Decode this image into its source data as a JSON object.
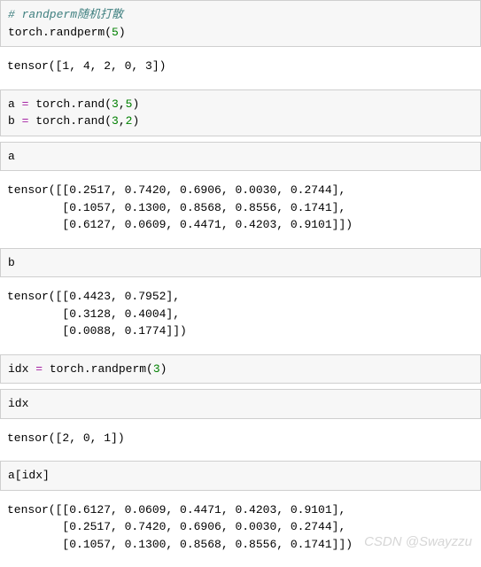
{
  "cells": {
    "c1_comment": "# randperm随机打散",
    "c1_code": "torch.randperm(",
    "c1_num": "5",
    "c1_close": ")",
    "o1": "tensor([1, 4, 2, 0, 3])",
    "c2_l1a": "a ",
    "c2_l1b": " torch.rand(",
    "c2_l1n1": "3",
    "c2_l1n2": "5",
    "c2_l1c": ")",
    "c2_l2a": "b ",
    "c2_l2b": " torch.rand(",
    "c2_l2n1": "3",
    "c2_l2n2": "2",
    "c2_l2c": ")",
    "eq": "=",
    "comma": ",",
    "c3": "a",
    "o3": "tensor([[0.2517, 0.7420, 0.6906, 0.0030, 0.2744],\n        [0.1057, 0.1300, 0.8568, 0.8556, 0.1741],\n        [0.6127, 0.0609, 0.4471, 0.4203, 0.9101]])",
    "c4": "b",
    "o4": "tensor([[0.4423, 0.7952],\n        [0.3128, 0.4004],\n        [0.0088, 0.1774]])",
    "c5a": "idx ",
    "c5b": " torch.randperm(",
    "c5n": "3",
    "c5c": ")",
    "c6": "idx",
    "o6": "tensor([2, 0, 1])",
    "c7": "a[idx]",
    "o7": "tensor([[0.6127, 0.0609, 0.4471, 0.4203, 0.9101],\n        [0.2517, 0.7420, 0.6906, 0.0030, 0.2744],\n        [0.1057, 0.1300, 0.8568, 0.8556, 0.1741]])"
  },
  "watermark": "CSDN @Swayzzu"
}
